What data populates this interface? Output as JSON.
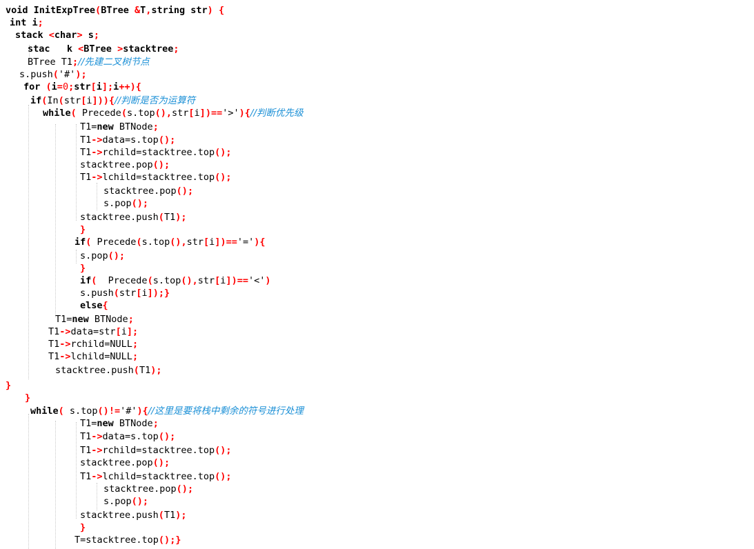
{
  "colors": {
    "background": "#ffffff",
    "text": "#000000",
    "operator": "#ff0000",
    "comment": "#1a8fd6",
    "guide": "#c8c8c8"
  },
  "lines": [
    {
      "tokens": [
        [
          "k",
          "void InitExpTree"
        ],
        [
          "p",
          "("
        ],
        [
          "k",
          "BTree "
        ],
        [
          "p",
          "&"
        ],
        [
          "k",
          "T"
        ],
        [
          "p",
          ","
        ],
        [
          "k",
          "string str"
        ],
        [
          "p",
          ")"
        ],
        [
          "k",
          " "
        ],
        [
          "p",
          "{"
        ]
      ]
    },
    {
      "tokens": [
        [
          "k",
          "int i"
        ],
        [
          "p",
          ";"
        ]
      ]
    },
    {
      "tokens": [
        [
          "k",
          "stack "
        ],
        [
          "p",
          "<"
        ],
        [
          "k",
          "char"
        ],
        [
          "p",
          "> "
        ],
        [
          "k",
          "s"
        ],
        [
          "p",
          ";"
        ]
      ]
    },
    {
      "tokens": [
        [
          "k",
          "stac   k "
        ],
        [
          "p",
          "<"
        ],
        [
          "k",
          "BTree "
        ],
        [
          "p",
          ">"
        ],
        [
          "k",
          "stacktree"
        ],
        [
          "p",
          ";"
        ]
      ]
    },
    {
      "tokens": [
        [
          "t",
          "BTree T1"
        ],
        [
          "p",
          ";"
        ],
        [
          "c",
          "//先建二叉树节点"
        ]
      ]
    },
    {
      "tokens": [
        [
          "t",
          "s.push"
        ],
        [
          "p",
          "("
        ],
        [
          "t",
          "'#'"
        ],
        [
          "p",
          ")"
        ],
        [
          "p",
          ";"
        ]
      ]
    },
    {
      "tokens": [
        [
          "k",
          "for "
        ],
        [
          "p",
          "("
        ],
        [
          "k",
          "i"
        ],
        [
          "p",
          "="
        ],
        [
          "n",
          "0"
        ],
        [
          "p",
          ";"
        ],
        [
          "k",
          "str"
        ],
        [
          "p",
          "["
        ],
        [
          "k",
          "i"
        ],
        [
          "p",
          "]"
        ],
        [
          "p",
          ";"
        ],
        [
          "k",
          "i"
        ],
        [
          "p",
          "++"
        ],
        [
          "p",
          ")"
        ],
        [
          "p",
          "{"
        ]
      ]
    },
    {
      "tokens": [
        [
          "k",
          "if"
        ],
        [
          "p",
          "("
        ],
        [
          "t",
          "In"
        ],
        [
          "p",
          "("
        ],
        [
          "t",
          "str"
        ],
        [
          "p",
          "["
        ],
        [
          "t",
          "i"
        ],
        [
          "p",
          "]"
        ],
        [
          "p",
          ")"
        ],
        [
          "p",
          ")"
        ],
        [
          "p",
          "{"
        ],
        [
          "c",
          "//判断是否为运算符"
        ]
      ]
    },
    {
      "tokens": [
        [
          "k",
          "while"
        ],
        [
          "p",
          "( "
        ],
        [
          "t",
          "Precede"
        ],
        [
          "p",
          "("
        ],
        [
          "t",
          "s.top"
        ],
        [
          "p",
          "()"
        ],
        [
          "p",
          ","
        ],
        [
          "t",
          "str"
        ],
        [
          "p",
          "["
        ],
        [
          "t",
          "i"
        ],
        [
          "p",
          "]"
        ],
        [
          "p",
          ")"
        ],
        [
          "p",
          "=="
        ],
        [
          "t",
          "'>'"
        ],
        [
          "p",
          ")"
        ],
        [
          "p",
          "{"
        ],
        [
          "c",
          "//判断优先级"
        ]
      ]
    },
    {
      "tokens": [
        [
          "t",
          "T1="
        ],
        [
          "k",
          "new"
        ],
        [
          "t",
          " BTNode"
        ],
        [
          "p",
          ";"
        ]
      ]
    },
    {
      "tokens": [
        [
          "t",
          "T1"
        ],
        [
          "p",
          "->"
        ],
        [
          "t",
          "data=s.top"
        ],
        [
          "p",
          "()"
        ],
        [
          "p",
          ";"
        ]
      ]
    },
    {
      "tokens": [
        [
          "t",
          "T1"
        ],
        [
          "p",
          "->"
        ],
        [
          "t",
          "rchild=stacktree.top"
        ],
        [
          "p",
          "()"
        ],
        [
          "p",
          ";"
        ]
      ]
    },
    {
      "tokens": [
        [
          "t",
          "stacktree.pop"
        ],
        [
          "p",
          "()"
        ],
        [
          "p",
          ";"
        ]
      ]
    },
    {
      "tokens": [
        [
          "t",
          "T1"
        ],
        [
          "p",
          "->"
        ],
        [
          "t",
          "lchild=stacktree.top"
        ],
        [
          "p",
          "()"
        ],
        [
          "p",
          ";"
        ]
      ]
    },
    {
      "tokens": [
        [
          "t",
          "stacktree.pop"
        ],
        [
          "p",
          "()"
        ],
        [
          "p",
          ";"
        ]
      ]
    },
    {
      "tokens": [
        [
          "t",
          "s.pop"
        ],
        [
          "p",
          "()"
        ],
        [
          "p",
          ";"
        ]
      ]
    },
    {
      "tokens": [
        [
          "t",
          "stacktree.push"
        ],
        [
          "p",
          "("
        ],
        [
          "t",
          "T1"
        ],
        [
          "p",
          ")"
        ],
        [
          "p",
          ";"
        ]
      ]
    },
    {
      "tokens": [
        [
          "p",
          "}"
        ]
      ]
    },
    {
      "tokens": [
        [
          "k",
          "if"
        ],
        [
          "p",
          "( "
        ],
        [
          "t",
          "Precede"
        ],
        [
          "p",
          "("
        ],
        [
          "t",
          "s.top"
        ],
        [
          "p",
          "()"
        ],
        [
          "p",
          ","
        ],
        [
          "t",
          "str"
        ],
        [
          "p",
          "["
        ],
        [
          "t",
          "i"
        ],
        [
          "p",
          "]"
        ],
        [
          "p",
          ")"
        ],
        [
          "p",
          "=="
        ],
        [
          "t",
          "'='"
        ],
        [
          "p",
          ")"
        ],
        [
          "p",
          "{"
        ]
      ]
    },
    {
      "tokens": [
        [
          "t",
          "s.pop"
        ],
        [
          "p",
          "()"
        ],
        [
          "p",
          ";"
        ]
      ]
    },
    {
      "tokens": [
        [
          "p",
          "}"
        ]
      ]
    },
    {
      "tokens": [
        [
          "k",
          "if"
        ],
        [
          "p",
          "(  "
        ],
        [
          "t",
          "Precede"
        ],
        [
          "p",
          "("
        ],
        [
          "t",
          "s.top"
        ],
        [
          "p",
          "()"
        ],
        [
          "p",
          ","
        ],
        [
          "t",
          "str"
        ],
        [
          "p",
          "["
        ],
        [
          "t",
          "i"
        ],
        [
          "p",
          "]"
        ],
        [
          "p",
          ")"
        ],
        [
          "p",
          "=="
        ],
        [
          "t",
          "'<'"
        ],
        [
          "p",
          ")"
        ]
      ]
    },
    {
      "tokens": [
        [
          "t",
          "s.push"
        ],
        [
          "p",
          "("
        ],
        [
          "t",
          "str"
        ],
        [
          "p",
          "["
        ],
        [
          "t",
          "i"
        ],
        [
          "p",
          "]"
        ],
        [
          "p",
          ")"
        ],
        [
          "p",
          ";"
        ],
        [
          "p",
          "}"
        ]
      ]
    },
    {
      "tokens": [
        [
          "k",
          "else"
        ],
        [
          "p",
          "{"
        ]
      ]
    },
    {
      "tokens": [
        [
          "t",
          "T1="
        ],
        [
          "k",
          "new"
        ],
        [
          "t",
          " BTNode"
        ],
        [
          "p",
          ";"
        ]
      ]
    },
    {
      "tokens": [
        [
          "t",
          "T1"
        ],
        [
          "p",
          "->"
        ],
        [
          "t",
          "data=str"
        ],
        [
          "p",
          "["
        ],
        [
          "t",
          "i"
        ],
        [
          "p",
          "]"
        ],
        [
          "p",
          ";"
        ]
      ]
    },
    {
      "tokens": [
        [
          "t",
          "T1"
        ],
        [
          "p",
          "->"
        ],
        [
          "t",
          "rchild=NULL"
        ],
        [
          "p",
          ";"
        ]
      ]
    },
    {
      "tokens": [
        [
          "t",
          "T1"
        ],
        [
          "p",
          "->"
        ],
        [
          "t",
          "lchild=NULL"
        ],
        [
          "p",
          ";"
        ]
      ]
    },
    {
      "tokens": [
        [
          "t",
          "stacktree.push"
        ],
        [
          "p",
          "("
        ],
        [
          "t",
          "T1"
        ],
        [
          "p",
          ")"
        ],
        [
          "p",
          ";"
        ]
      ]
    },
    {
      "tokens": [
        [
          "p",
          "}"
        ]
      ]
    },
    {
      "tokens": [
        [
          "p",
          "}"
        ]
      ]
    },
    {
      "tokens": [
        [
          "k",
          "while"
        ],
        [
          "p",
          "( "
        ],
        [
          "t",
          "s.top"
        ],
        [
          "p",
          "()"
        ],
        [
          "p",
          "!="
        ],
        [
          "t",
          "'#'"
        ],
        [
          "p",
          ")"
        ],
        [
          "p",
          "{"
        ],
        [
          "c",
          "//这里是要将栈中剩余的符号进行处理"
        ]
      ]
    },
    {
      "tokens": [
        [
          "t",
          "T1="
        ],
        [
          "k",
          "new"
        ],
        [
          "t",
          " BTNode"
        ],
        [
          "p",
          ";"
        ]
      ]
    },
    {
      "tokens": [
        [
          "t",
          "T1"
        ],
        [
          "p",
          "->"
        ],
        [
          "t",
          "data=s.top"
        ],
        [
          "p",
          "()"
        ],
        [
          "p",
          ";"
        ]
      ]
    },
    {
      "tokens": [
        [
          "t",
          "T1"
        ],
        [
          "p",
          "->"
        ],
        [
          "t",
          "rchild=stacktree.top"
        ],
        [
          "p",
          "()"
        ],
        [
          "p",
          ";"
        ]
      ]
    },
    {
      "tokens": [
        [
          "t",
          "stacktree.pop"
        ],
        [
          "p",
          "()"
        ],
        [
          "p",
          ";"
        ]
      ]
    },
    {
      "tokens": [
        [
          "t",
          "T1"
        ],
        [
          "p",
          "->"
        ],
        [
          "t",
          "lchild=stacktree.top"
        ],
        [
          "p",
          "()"
        ],
        [
          "p",
          ";"
        ]
      ]
    },
    {
      "tokens": [
        [
          "t",
          "stacktree.pop"
        ],
        [
          "p",
          "()"
        ],
        [
          "p",
          ";"
        ]
      ]
    },
    {
      "tokens": [
        [
          "t",
          "s.pop"
        ],
        [
          "p",
          "()"
        ],
        [
          "p",
          ";"
        ]
      ]
    },
    {
      "tokens": [
        [
          "t",
          "stacktree.push"
        ],
        [
          "p",
          "("
        ],
        [
          "t",
          "T1"
        ],
        [
          "p",
          ")"
        ],
        [
          "p",
          ";"
        ]
      ]
    },
    {
      "tokens": [
        [
          "p",
          "}"
        ]
      ]
    },
    {
      "tokens": [
        [
          "t",
          "T=stacktree.top"
        ],
        [
          "p",
          "()"
        ],
        [
          "p",
          ";"
        ],
        [
          "p",
          "}"
        ]
      ]
    }
  ]
}
